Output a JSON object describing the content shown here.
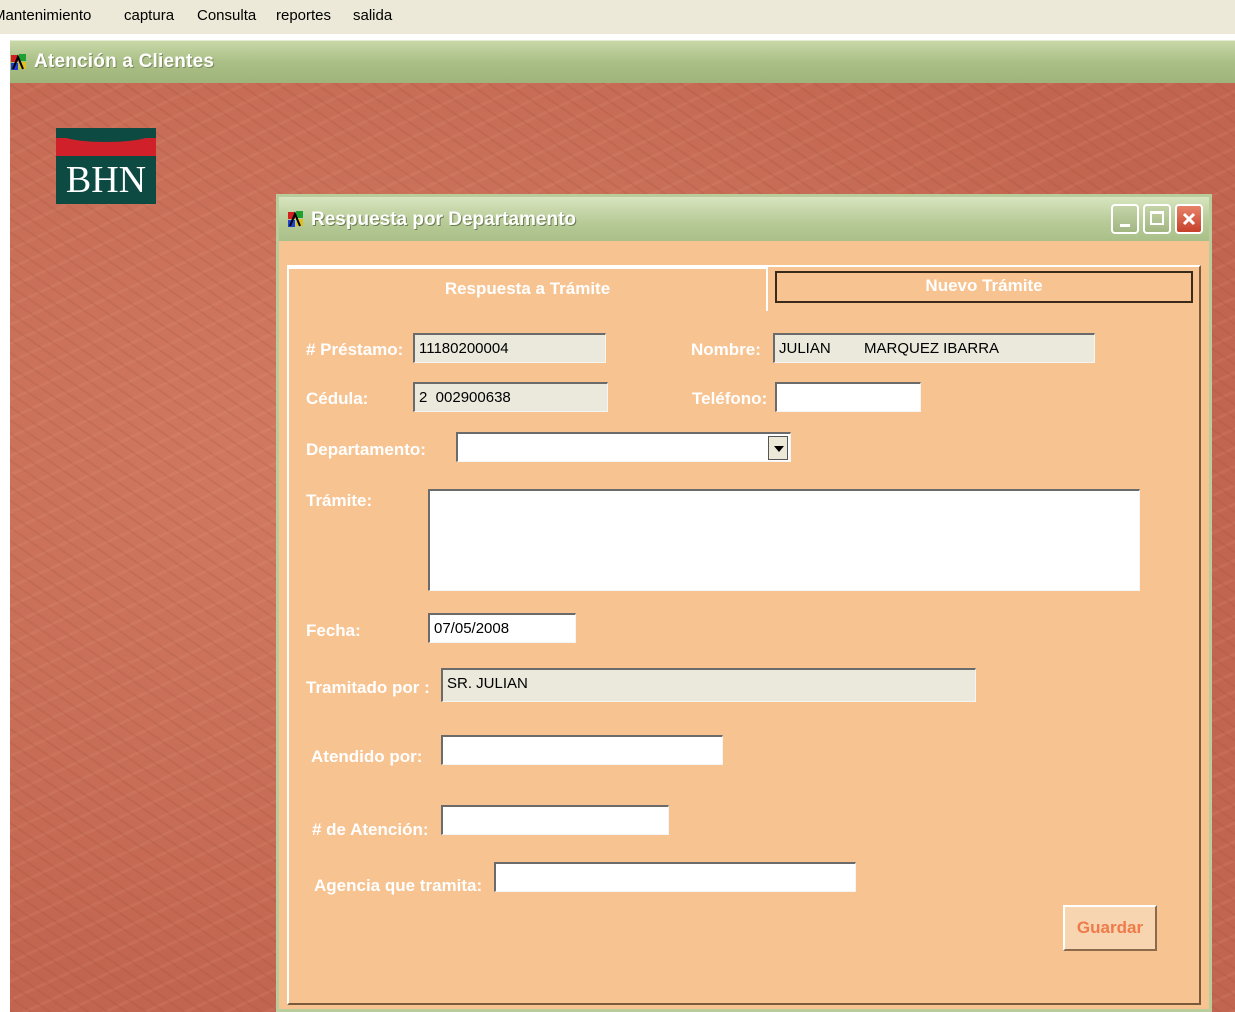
{
  "menu": {
    "items": [
      "Mantenimiento",
      "captura",
      "Consulta",
      "reportes",
      "salida"
    ]
  },
  "app": {
    "title": "Atención a Clientes",
    "logo_text": "BHN"
  },
  "dialog": {
    "title": "Respuesta por Departamento",
    "tabs": [
      {
        "label": "Respuesta a Trámite"
      },
      {
        "label": "Nuevo Trámite"
      }
    ],
    "form": {
      "prestamo_label": "# Préstamo:",
      "prestamo_value": "11180200004",
      "nombre_label": "Nombre:",
      "nombre_value": "JULIAN        MARQUEZ IBARRA",
      "cedula_label": "Cédula:",
      "cedula_value": "2  002900638",
      "telefono_label": "Teléfono:",
      "telefono_value": "",
      "departamento_label": "Departamento:",
      "departamento_value": "",
      "tramite_label": "Trámite:",
      "tramite_value": "",
      "fecha_label": "Fecha:",
      "fecha_value": "07/05/2008",
      "tramitado_label": "Tramitado por :",
      "tramitado_value": "SR. JULIAN",
      "atendido_label": "Atendido por:",
      "atendido_value": "",
      "atencion_label": "# de Atención:",
      "atencion_value": "",
      "agencia_label": "Agencia que tramita:",
      "agencia_value": ""
    },
    "save_label": "Guardar"
  },
  "colors": {
    "dialog_bg": "#f7c391",
    "title_bar": "#b8cb98",
    "desktop": "#c9705a",
    "close_button": "#c6412a"
  }
}
